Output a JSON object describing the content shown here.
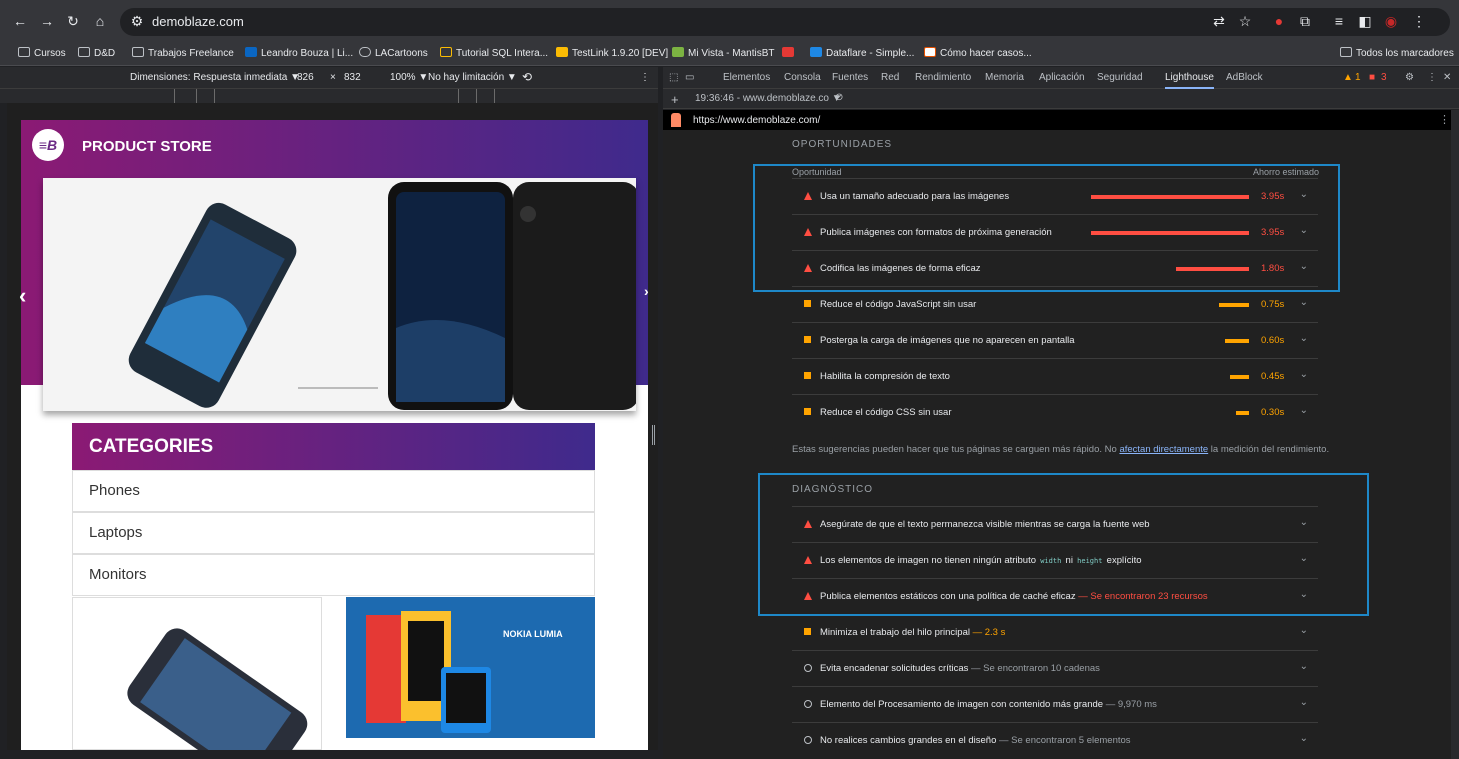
{
  "browser": {
    "url": "demoblaze.com",
    "bookmarks": [
      "Cursos",
      "D&D",
      "Trabajos Freelance",
      "Leandro Bouza | Li...",
      "LACartoons",
      "Tutorial SQL Intera...",
      "TestLink 1.9.20 [DEV]",
      "Mi Vista - MantisBT",
      "",
      "Dataflare - Simple...",
      "Cómo hacer casos..."
    ],
    "all_bookmarks": "Todos los marcadores"
  },
  "device_toolbar": {
    "dimensions": "Dimensiones: Respuesta inmediata ▼",
    "width": "826",
    "x": "×",
    "height": "832",
    "zoom": "100% ▼",
    "throttle": "No hay limitación ▼"
  },
  "site": {
    "logo": "≡B",
    "store_name": "PRODUCT STORE",
    "categories_title": "CATEGORIES",
    "categories": [
      "Phones",
      "Laptops",
      "Monitors"
    ],
    "card2_brand": "NOKIA LUMIA"
  },
  "devtools": {
    "tabs": [
      "Elementos",
      "Consola",
      "Fuentes",
      "Red",
      "Rendimiento",
      "Memoria",
      "Aplicación",
      "Seguridad",
      "Lighthouse",
      "AdBlock"
    ],
    "active_tab": "Lighthouse",
    "warnings": "1",
    "errors": "3",
    "report_select": "19:36:46 - www.demoblaze.co ▼",
    "report_url": "https://www.demoblaze.com/"
  },
  "opportunities": {
    "title": "OPORTUNIDADES",
    "col_left": "Oportunidad",
    "col_right": "Ahorro estimado",
    "items": [
      {
        "label": "Usa un tamaño adecuado para las imágenes",
        "value": "3.95s",
        "level": "red",
        "fraction": 1.0
      },
      {
        "label": "Publica imágenes con formatos de próxima generación",
        "value": "3.95s",
        "level": "red",
        "fraction": 1.0
      },
      {
        "label": "Codifica las imágenes de forma eficaz",
        "value": "1.80s",
        "level": "red",
        "fraction": 0.46
      },
      {
        "label": "Reduce el código JavaScript sin usar",
        "value": "0.75s",
        "level": "orange",
        "fraction": 0.19
      },
      {
        "label": "Posterga la carga de imágenes que no aparecen en pantalla",
        "value": "0.60s",
        "level": "orange",
        "fraction": 0.15
      },
      {
        "label": "Habilita la compresión de texto",
        "value": "0.45s",
        "level": "orange",
        "fraction": 0.12
      },
      {
        "label": "Reduce el código CSS sin usar",
        "value": "0.30s",
        "level": "orange",
        "fraction": 0.08
      }
    ],
    "note_pre": "Estas sugerencias pueden hacer que tus páginas se carguen más rápido. No ",
    "note_link": "afectan directamente",
    "note_post": " la medición del rendimiento."
  },
  "diagnostics": {
    "title": "DIAGNÓSTICO",
    "items": [
      {
        "label": "Asegúrate de que el texto permanezca visible mientras se carga la fuente web",
        "extra": "",
        "level": "red"
      },
      {
        "label": "Los elementos de imagen no tienen ningún atributo",
        "code1": "width",
        "mid": "ni",
        "code2": "height",
        "tail": "explícito",
        "level": "red"
      },
      {
        "label": "Publica elementos estáticos con una política de caché eficaz",
        "extra": "— Se encontraron 23 recursos",
        "level": "red"
      },
      {
        "label": "Minimiza el trabajo del hilo principal",
        "extra": "— 2.3 s",
        "level": "orange"
      },
      {
        "label": "Evita encadenar solicitudes críticas",
        "extra": "— Se encontraron 10 cadenas",
        "level": "gray"
      },
      {
        "label": "Elemento del Procesamiento de imagen con contenido más grande",
        "extra": "— 9,970 ms",
        "level": "gray"
      },
      {
        "label": "No realices cambios grandes en el diseño",
        "extra": "— Se encontraron 5 elementos",
        "level": "gray"
      }
    ]
  }
}
